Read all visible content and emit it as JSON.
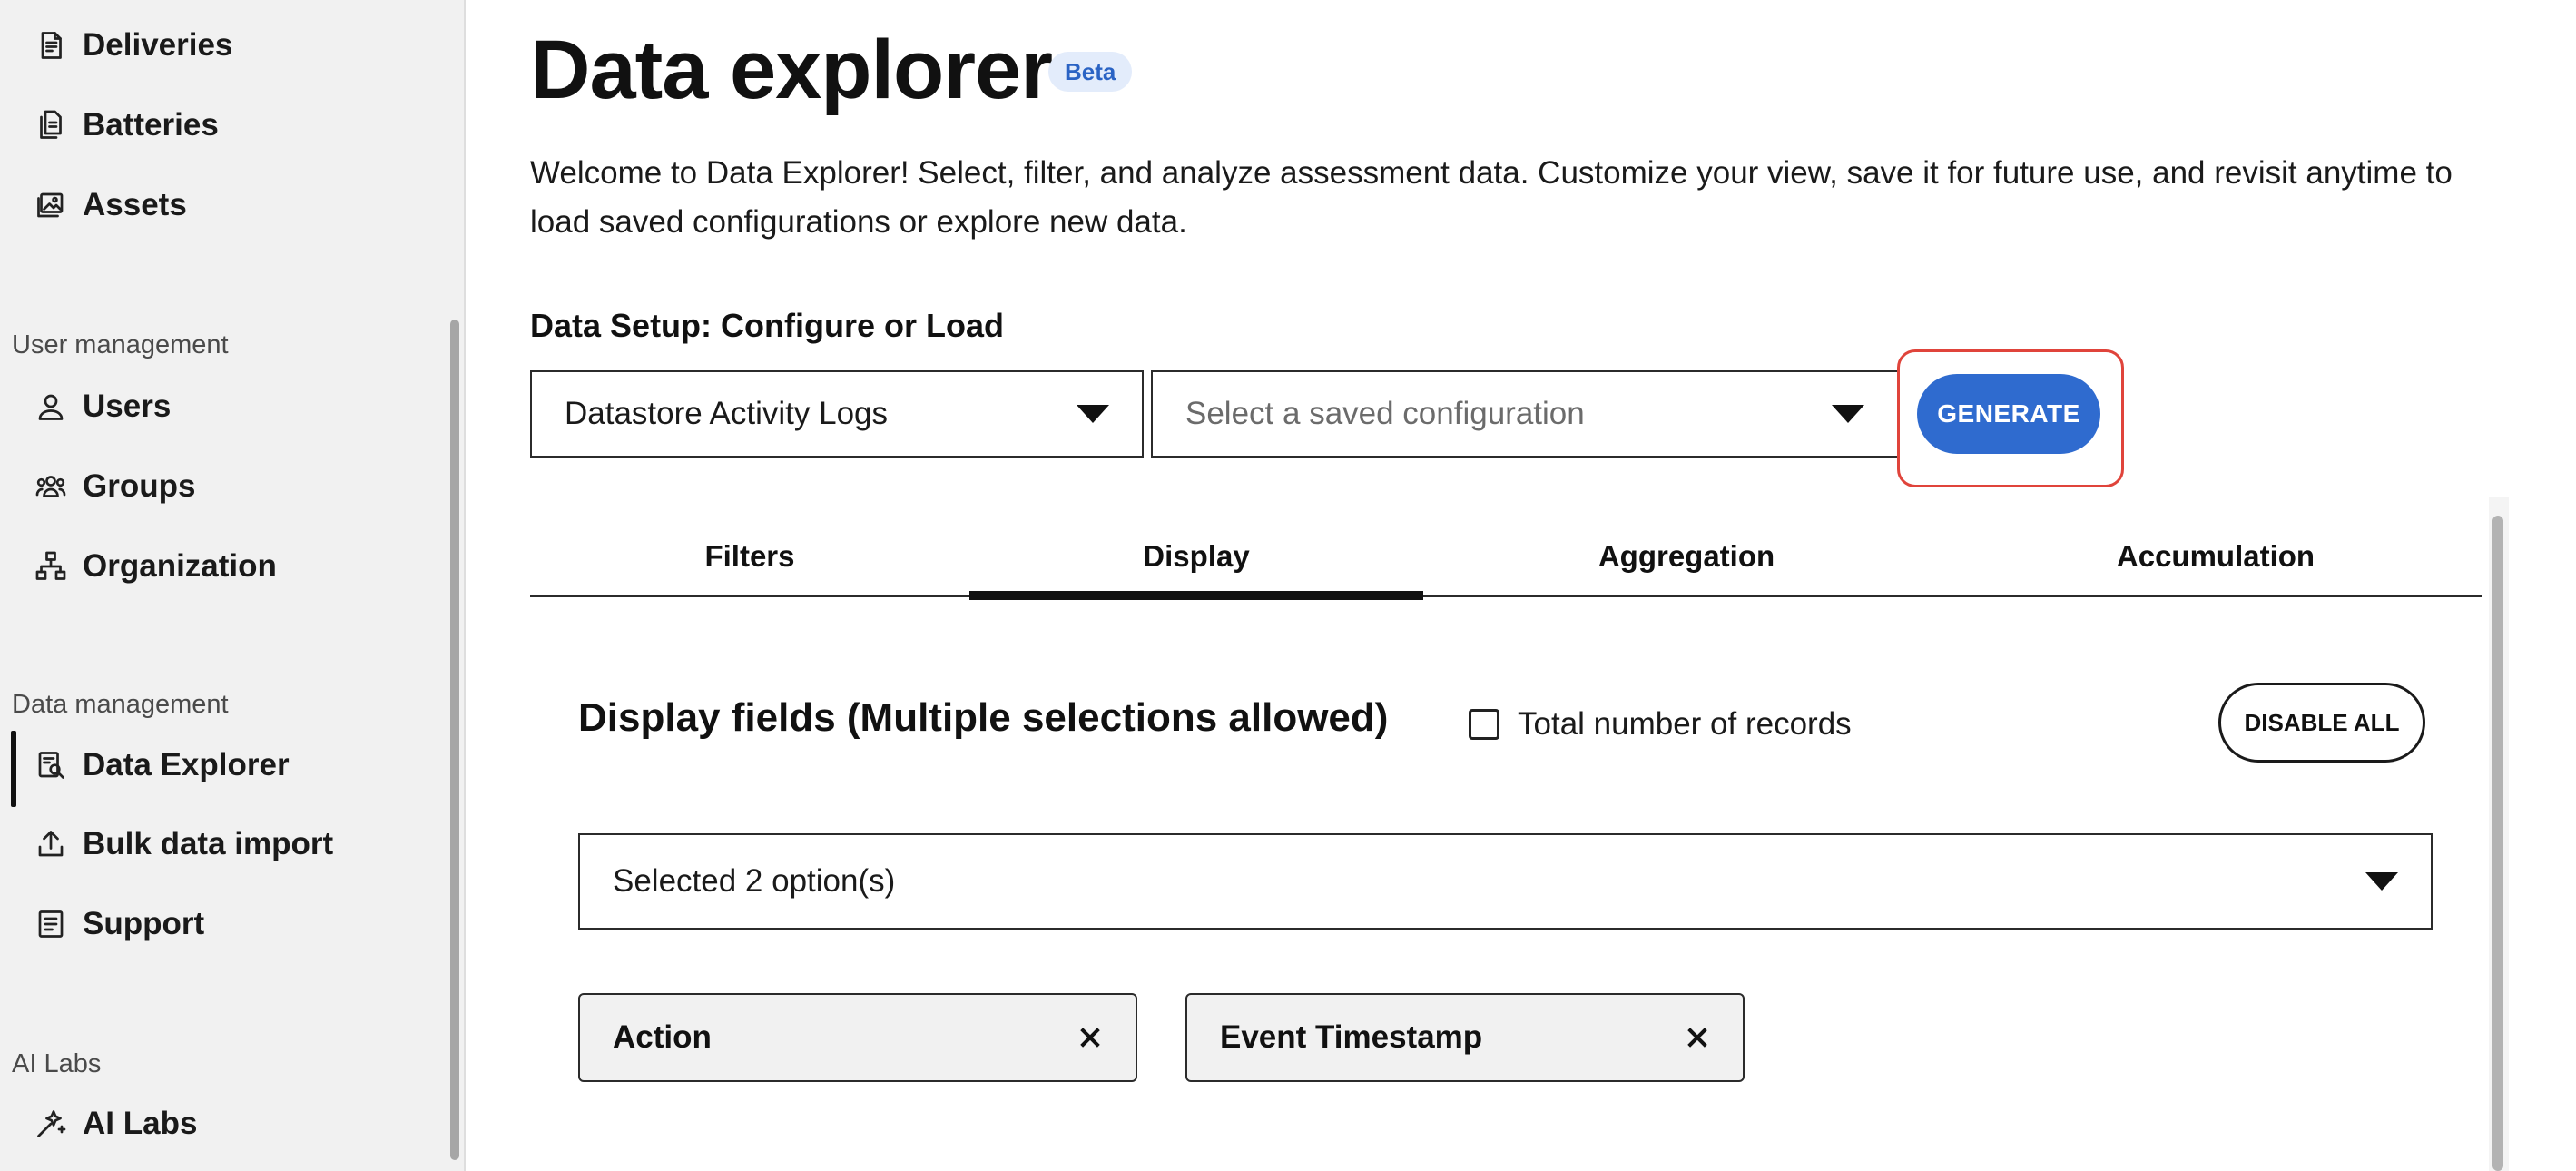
{
  "sidebar": {
    "items_top": [
      {
        "label": "Deliveries",
        "icon": "deliveries-doc-icon"
      },
      {
        "label": "Batteries",
        "icon": "batteries-files-icon"
      },
      {
        "label": "Assets",
        "icon": "assets-image-icon"
      }
    ],
    "sections": {
      "user_management": "User management",
      "data_management": "Data management",
      "ai_labs": "AI Labs"
    },
    "user_items": [
      {
        "label": "Users",
        "icon": "user-icon"
      },
      {
        "label": "Groups",
        "icon": "groups-icon"
      },
      {
        "label": "Organization",
        "icon": "organization-icon"
      }
    ],
    "data_items": [
      {
        "label": "Data Explorer",
        "icon": "data-explorer-icon",
        "active": true
      },
      {
        "label": "Bulk data import",
        "icon": "upload-icon"
      },
      {
        "label": "Support",
        "icon": "support-icon"
      }
    ],
    "ai_items": [
      {
        "label": "AI Labs",
        "icon": "sparkle-icon"
      }
    ]
  },
  "page": {
    "title": "Data explorer",
    "badge": "Beta",
    "intro": "Welcome to Data Explorer! Select, filter, and analyze assessment data. Customize your view, save it for future use, and revisit anytime to load saved configurations or explore new data."
  },
  "setup": {
    "title": "Data Setup: Configure or Load",
    "dataset_value": "Datastore Activity Logs",
    "config_placeholder": "Select a saved configuration",
    "generate_label": "GENERATE"
  },
  "tabs": [
    {
      "label": "Filters",
      "active": false
    },
    {
      "label": "Display",
      "active": true
    },
    {
      "label": "Aggregation",
      "active": false
    },
    {
      "label": "Accumulation",
      "active": false
    }
  ],
  "display": {
    "title": "Display fields (Multiple selections allowed)",
    "total_records_label": "Total number of records",
    "total_records_checked": false,
    "disable_all_label": "DISABLE ALL",
    "selected_summary": "Selected 2 option(s)",
    "chips": [
      "Action",
      "Event Timestamp"
    ]
  },
  "colors": {
    "accent": "#2f6bcf",
    "highlight": "#e0443b",
    "sidebar_bg": "#f1f1f1",
    "badge_bg": "#e3ecfb",
    "badge_text": "#2a63c4"
  }
}
